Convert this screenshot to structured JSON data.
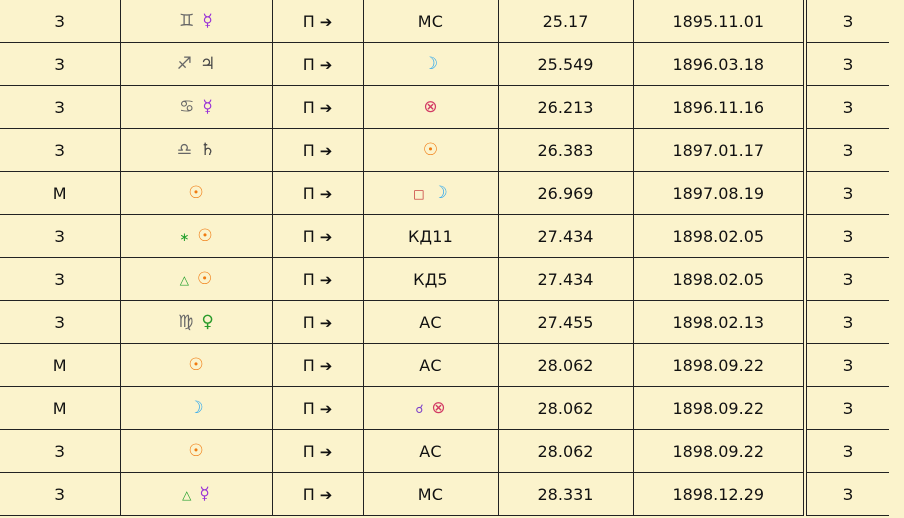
{
  "columns": [
    "type",
    "promissor",
    "motion",
    "significator",
    "arc",
    "date",
    "type_right"
  ],
  "rows": [
    {
      "type": "З",
      "promissor": [
        {
          "g": "♊",
          "c": "#666666",
          "icon": "gemini-sign-icon"
        },
        {
          "g": "☿",
          "c": "#9a33d6",
          "icon": "mercury-icon"
        }
      ],
      "motion": "П",
      "arrow": "➔",
      "significator": [
        {
          "t": "МС"
        }
      ],
      "arc": "25.17",
      "date": "1895.11.01",
      "type_right": "З"
    },
    {
      "type": "З",
      "promissor": [
        {
          "g": "♐",
          "c": "#666666",
          "icon": "sagittarius-sign-icon"
        },
        {
          "g": "♃",
          "c": "#444444",
          "icon": "jupiter-icon"
        }
      ],
      "motion": "П",
      "arrow": "➔",
      "significator": [
        {
          "g": "☽",
          "c": "#2aa6ee",
          "icon": "moon-icon"
        }
      ],
      "arc": "25.549",
      "date": "1896.03.18",
      "type_right": "З"
    },
    {
      "type": "З",
      "promissor": [
        {
          "g": "♋",
          "c": "#666666",
          "icon": "cancer-sign-icon"
        },
        {
          "g": "☿",
          "c": "#9a33d6",
          "icon": "mercury-icon"
        }
      ],
      "motion": "П",
      "arrow": "➔",
      "significator": [
        {
          "g": "⊗",
          "c": "#d23a64",
          "icon": "part-of-fortune-icon"
        }
      ],
      "arc": "26.213",
      "date": "1896.11.16",
      "type_right": "З"
    },
    {
      "type": "З",
      "promissor": [
        {
          "g": "♎",
          "c": "#666666",
          "icon": "libra-sign-icon"
        },
        {
          "g": "♄",
          "c": "#444444",
          "icon": "saturn-icon"
        }
      ],
      "motion": "П",
      "arrow": "➔",
      "significator": [
        {
          "g": "☉",
          "c": "#f07b10",
          "icon": "sun-icon"
        }
      ],
      "arc": "26.383",
      "date": "1897.01.17",
      "type_right": "З"
    },
    {
      "type": "М",
      "promissor": [
        {
          "g": "☉",
          "c": "#f07b10",
          "icon": "sun-icon"
        }
      ],
      "motion": "П",
      "arrow": "➔",
      "significator": [
        {
          "g": "□",
          "c": "#c0282a",
          "icon": "square-aspect-icon",
          "small": true
        },
        {
          "g": "☽",
          "c": "#2aa6ee",
          "icon": "moon-icon"
        }
      ],
      "arc": "26.969",
      "date": "1897.08.19",
      "type_right": "З"
    },
    {
      "type": "З",
      "promissor": [
        {
          "g": "∗",
          "c": "#1f9e2a",
          "icon": "sextile-aspect-icon",
          "small": true
        },
        {
          "g": "☉",
          "c": "#f07b10",
          "icon": "sun-icon"
        }
      ],
      "motion": "П",
      "arrow": "➔",
      "significator": [
        {
          "t": "КД11"
        }
      ],
      "arc": "27.434",
      "date": "1898.02.05",
      "type_right": "З"
    },
    {
      "type": "З",
      "promissor": [
        {
          "g": "△",
          "c": "#1f9e2a",
          "icon": "trine-aspect-icon",
          "small": true
        },
        {
          "g": "☉",
          "c": "#f07b10",
          "icon": "sun-icon"
        }
      ],
      "motion": "П",
      "arrow": "➔",
      "significator": [
        {
          "t": "КД5"
        }
      ],
      "arc": "27.434",
      "date": "1898.02.05",
      "type_right": "З"
    },
    {
      "type": "З",
      "promissor": [
        {
          "g": "♍",
          "c": "#666666",
          "icon": "virgo-sign-icon"
        },
        {
          "g": "♀",
          "c": "#2b9b2b",
          "icon": "venus-icon"
        }
      ],
      "motion": "П",
      "arrow": "➔",
      "significator": [
        {
          "t": "АС"
        }
      ],
      "arc": "27.455",
      "date": "1898.02.13",
      "type_right": "З"
    },
    {
      "type": "М",
      "promissor": [
        {
          "g": "☉",
          "c": "#f07b10",
          "icon": "sun-icon"
        }
      ],
      "motion": "П",
      "arrow": "➔",
      "significator": [
        {
          "t": "АС"
        }
      ],
      "arc": "28.062",
      "date": "1898.09.22",
      "type_right": "З"
    },
    {
      "type": "М",
      "promissor": [
        {
          "g": "☽",
          "c": "#2aa6ee",
          "icon": "moon-icon"
        }
      ],
      "motion": "П",
      "arrow": "➔",
      "significator": [
        {
          "g": "☌",
          "c": "#7a3cc9",
          "icon": "conjunction-aspect-icon",
          "small": true
        },
        {
          "g": "⊗",
          "c": "#d23a64",
          "icon": "part-of-fortune-icon"
        }
      ],
      "arc": "28.062",
      "date": "1898.09.22",
      "type_right": "З"
    },
    {
      "type": "З",
      "promissor": [
        {
          "g": "☉",
          "c": "#f07b10",
          "icon": "sun-icon"
        }
      ],
      "motion": "П",
      "arrow": "➔",
      "significator": [
        {
          "t": "АС"
        }
      ],
      "arc": "28.062",
      "date": "1898.09.22",
      "type_right": "З"
    },
    {
      "type": "З",
      "promissor": [
        {
          "g": "△",
          "c": "#1f9e2a",
          "icon": "trine-aspect-icon",
          "small": true
        },
        {
          "g": "☿",
          "c": "#9a33d6",
          "icon": "mercury-icon"
        }
      ],
      "motion": "П",
      "arrow": "➔",
      "significator": [
        {
          "t": "МС"
        }
      ],
      "arc": "28.331",
      "date": "1898.12.29",
      "type_right": "З"
    }
  ]
}
